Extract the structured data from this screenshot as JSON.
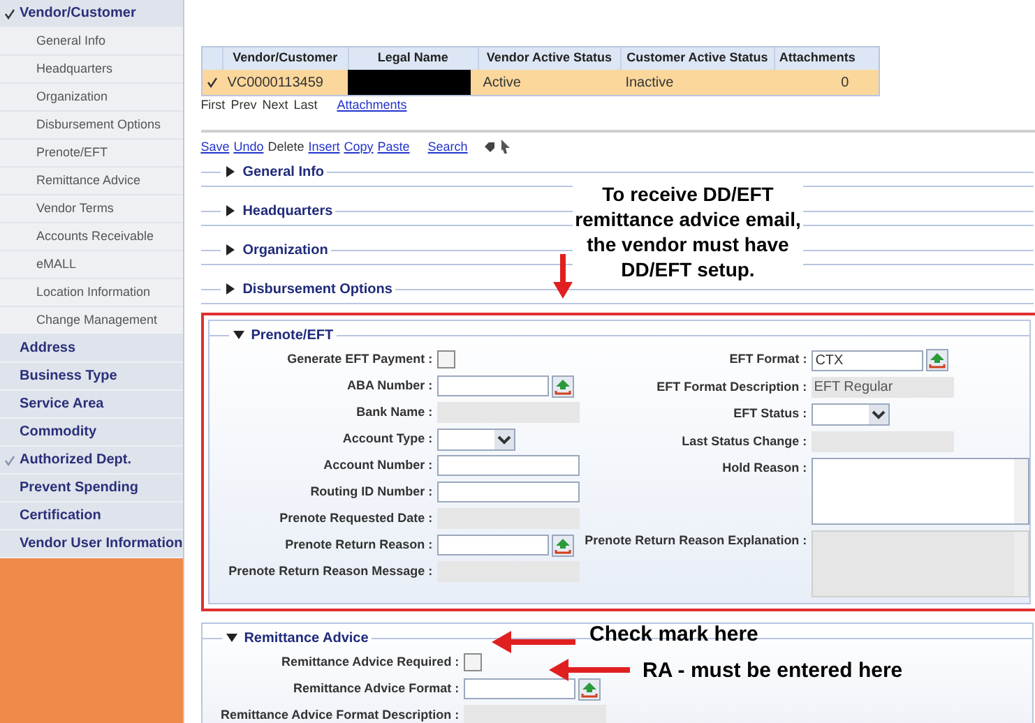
{
  "sidebar": {
    "items": [
      {
        "label": "Vendor/Customer",
        "checked": true,
        "children": [
          {
            "label": "General Info"
          },
          {
            "label": "Headquarters"
          },
          {
            "label": "Organization"
          },
          {
            "label": "Disbursement Options"
          },
          {
            "label": "Prenote/EFT"
          },
          {
            "label": "Remittance Advice"
          },
          {
            "label": "Vendor Terms"
          },
          {
            "label": "Accounts Receivable"
          },
          {
            "label": "eMALL"
          },
          {
            "label": "Location Information"
          },
          {
            "label": "Change Management"
          }
        ]
      },
      {
        "label": "Address",
        "checked": false
      },
      {
        "label": "Business Type",
        "checked": false
      },
      {
        "label": "Service Area",
        "checked": false
      },
      {
        "label": "Commodity",
        "checked": false
      },
      {
        "label": "Authorized Dept.",
        "checked": true
      },
      {
        "label": "Prevent Spending",
        "checked": false
      },
      {
        "label": "Certification",
        "checked": false
      },
      {
        "label": "Vendor User Information",
        "checked": false
      }
    ]
  },
  "table": {
    "columns": [
      "Vendor/Customer",
      "Legal Name",
      "Vendor Active Status",
      "Customer Active Status",
      "Attachments"
    ],
    "rows": [
      {
        "selected": true,
        "cells": [
          "VC0000113459",
          null,
          "Active",
          "Inactive",
          "0"
        ]
      }
    ]
  },
  "pager": [
    "First",
    "Prev",
    "Next",
    "Last"
  ],
  "pager_link": "Attachments",
  "toolbar": [
    {
      "label": "Save",
      "disabled": false
    },
    {
      "label": "Undo",
      "disabled": false
    },
    {
      "label": "Delete",
      "disabled": true
    },
    {
      "label": "Insert",
      "disabled": false
    },
    {
      "label": "Copy",
      "disabled": false
    },
    {
      "label": "Paste",
      "disabled": false
    },
    {
      "label": "Search",
      "disabled": false
    }
  ],
  "collapsed_sections": [
    {
      "title": "General Info",
      "expanded": false
    },
    {
      "title": "Headquarters",
      "expanded": false
    },
    {
      "title": "Organization",
      "expanded": false
    },
    {
      "title": "Disbursement Options",
      "expanded": false
    }
  ],
  "prenote": {
    "title": "Prenote/EFT",
    "expanded": true,
    "left": [
      {
        "label": "Generate EFT Payment :",
        "kind": "checkbox",
        "checked": false
      },
      {
        "label": "ABA Number :",
        "kind": "lookup"
      },
      {
        "label": "Bank Name :",
        "kind": "readonly"
      },
      {
        "label": "Account Type :",
        "kind": "select"
      },
      {
        "label": "Account Number :",
        "kind": "text"
      },
      {
        "label": "Routing ID Number :",
        "kind": "text"
      },
      {
        "label": "Prenote Requested Date :",
        "kind": "readonly"
      },
      {
        "label": "Prenote Return Reason :",
        "kind": "lookup"
      },
      {
        "label": "Prenote Return Reason Message :",
        "kind": "readonly"
      }
    ],
    "right": [
      {
        "label": "EFT Format :",
        "kind": "lookup",
        "value": "CTX"
      },
      {
        "label": "EFT Format Description :",
        "kind": "readonly",
        "value": "EFT Regular"
      },
      {
        "label": "EFT Status :",
        "kind": "select"
      },
      {
        "label": "Last Status Change :",
        "kind": "readonly"
      },
      {
        "label": "Hold Reason :",
        "kind": "textarea"
      },
      {
        "label": "Prenote Return Reason Explanation :",
        "kind": "textarea_readonly"
      }
    ]
  },
  "remittance": {
    "title": "Remittance Advice",
    "expanded": true,
    "fields": [
      {
        "label": "Remittance Advice Required :",
        "kind": "checkbox",
        "checked": false
      },
      {
        "label": "Remittance Advice Format :",
        "kind": "lookup"
      },
      {
        "label": "Remittance Advice Format Description :",
        "kind": "readonly"
      }
    ]
  },
  "annotations": [
    {
      "text": "To receive DD/EFT remittance advice email, the vendor must have DD/EFT setup."
    },
    {
      "text": "Check mark here"
    },
    {
      "text": "RA - must be entered here"
    }
  ]
}
